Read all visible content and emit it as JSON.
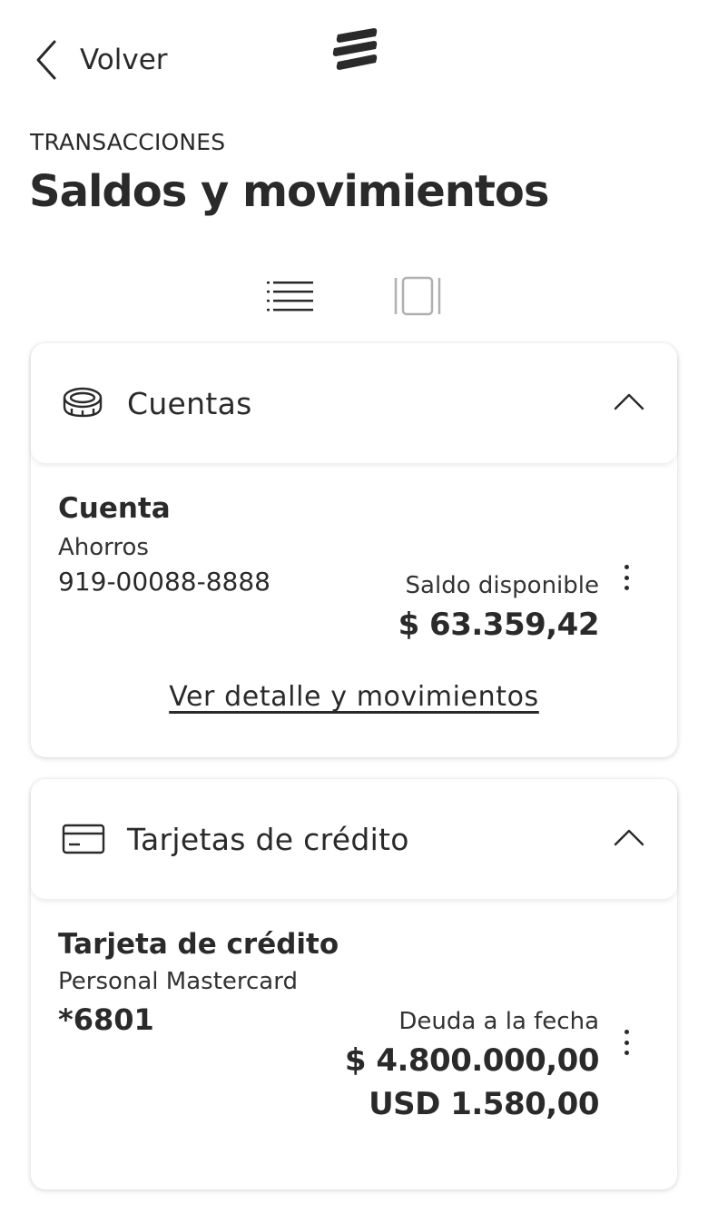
{
  "header": {
    "back_label": "Volver",
    "section_label": "TRANSACCIONES",
    "page_title": "Saldos y movimientos"
  },
  "view_toggle": {
    "options": [
      "list-view",
      "card-view"
    ],
    "selected": "list-view"
  },
  "accounts_section": {
    "title": "Cuentas",
    "icon": "coin-stack-icon",
    "expanded": true,
    "items": [
      {
        "name": "Cuenta",
        "type": "Ahorros",
        "number": "919-00088-8888",
        "balance_caption": "Saldo disponible",
        "balance": "$ 63.359,42",
        "detail_link": "Ver detalle y movimientos"
      }
    ]
  },
  "credit_cards_section": {
    "title": "Tarjetas de crédito",
    "icon": "credit-card-icon",
    "expanded": true,
    "items": [
      {
        "name": "Tarjeta de crédito",
        "type": "Personal Mastercard",
        "number": "*6801",
        "debt_caption": "Deuda a la fecha",
        "debt_local": "$ 4.800.000,00",
        "debt_usd": "USD 1.580,00"
      }
    ]
  },
  "colors": {
    "text": "#2a2a2a",
    "inactive_icon": "#b0b0b0",
    "background": "#ffffff"
  }
}
